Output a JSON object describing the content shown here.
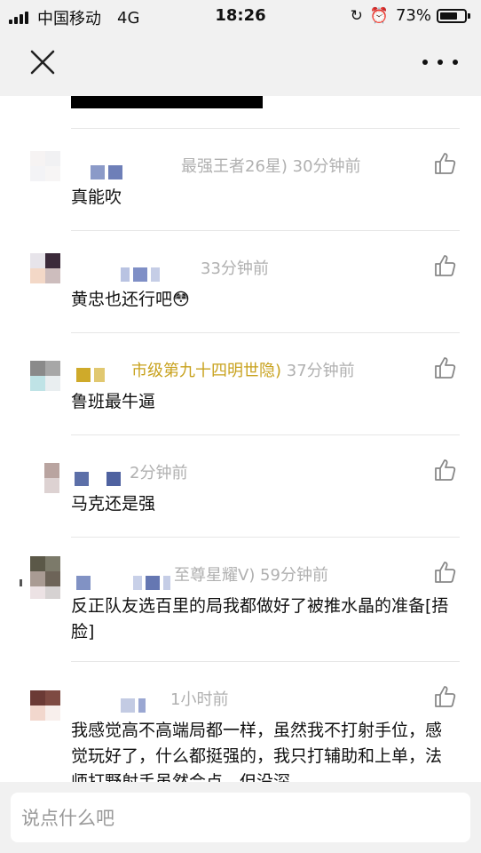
{
  "status_bar": {
    "carrier": "中国移动",
    "network": "4G",
    "time": "18:26",
    "battery": "73%",
    "battery_level": 0.73
  },
  "nav": {
    "close_icon": "close-icon",
    "more_icon": "more-dots-icon"
  },
  "comments": [
    {
      "meta": "最强王者26星) 30分钟前",
      "text": "真能吹"
    },
    {
      "meta": "33分钟前",
      "text": "黄忠也还行吧😳"
    },
    {
      "meta_gold": "市级第九十四明世隐)",
      "meta_time": "37分钟前",
      "text": "鲁班最牛逼"
    },
    {
      "meta": "2分钟前",
      "text": "马克还是强"
    },
    {
      "meta": "至尊星耀V) 59分钟前",
      "text": "反正队友选百里的局我都做好了被推水晶的准备[捂脸]"
    },
    {
      "meta": "1小时前",
      "text": "我感觉高不高端局都一样，虽然我不打射手位，感觉玩好了，什么都挺强的，我只打辅助和上单，法师打野射手虽然会点，但没深"
    }
  ],
  "input": {
    "placeholder": "说点什么吧"
  },
  "colors": {
    "bar_background": "#f1f1f1",
    "meta_gray": "#b0b0b0",
    "rank_gold": "#c8a21e"
  }
}
